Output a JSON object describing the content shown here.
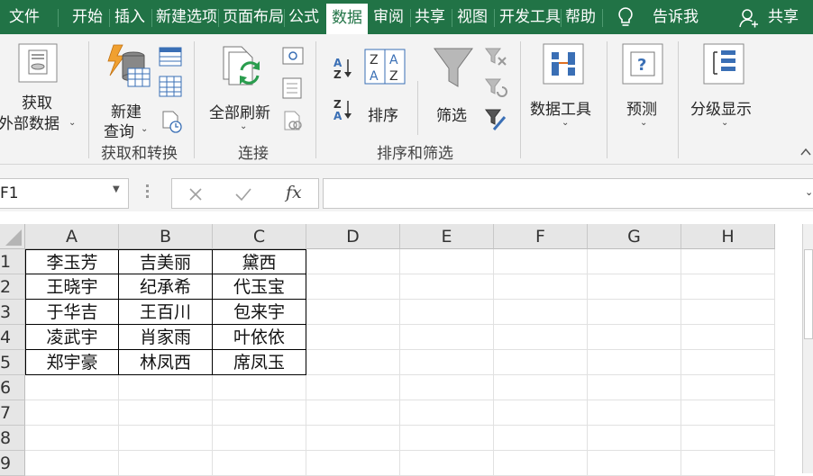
{
  "menu": {
    "tabs": [
      "文件",
      "开始",
      "插入",
      "新建选项",
      "页面布局",
      "公式",
      "数据",
      "审阅",
      "共享",
      "视图",
      "开发工具",
      "帮助"
    ],
    "active": "数据",
    "tell_me": "告诉我",
    "share": "共享"
  },
  "ribbon": {
    "get_external": [
      "获取",
      "外部数据"
    ],
    "new_query": [
      "新建",
      "查询"
    ],
    "group_get_transform": "获取和转换",
    "refresh_all": "全部刷新",
    "group_connections": "连接",
    "sort": "排序",
    "filter": "筛选",
    "group_sort_filter": "排序和筛选",
    "data_tools": "数据工具",
    "forecast": "预测",
    "outline": "分级显示"
  },
  "formula_bar": {
    "name_box": "F1",
    "fx": "fx",
    "formula": ""
  },
  "sheet": {
    "columns": [
      "A",
      "B",
      "C",
      "D",
      "E",
      "F",
      "G",
      "H"
    ],
    "rows": [
      "1",
      "2",
      "3",
      "4",
      "5",
      "6",
      "7",
      "8",
      "9"
    ],
    "data": [
      [
        "李玉芳",
        "吉美丽",
        "黛西"
      ],
      [
        "王晓宇",
        "纪承希",
        "代玉宝"
      ],
      [
        "于华吉",
        "王百川",
        "包来宇"
      ],
      [
        "凌武宇",
        "肖家雨",
        "叶依依"
      ],
      [
        "郑宇豪",
        "林凤西",
        "席凤玉"
      ]
    ]
  },
  "colors": {
    "accent": "#217346"
  }
}
